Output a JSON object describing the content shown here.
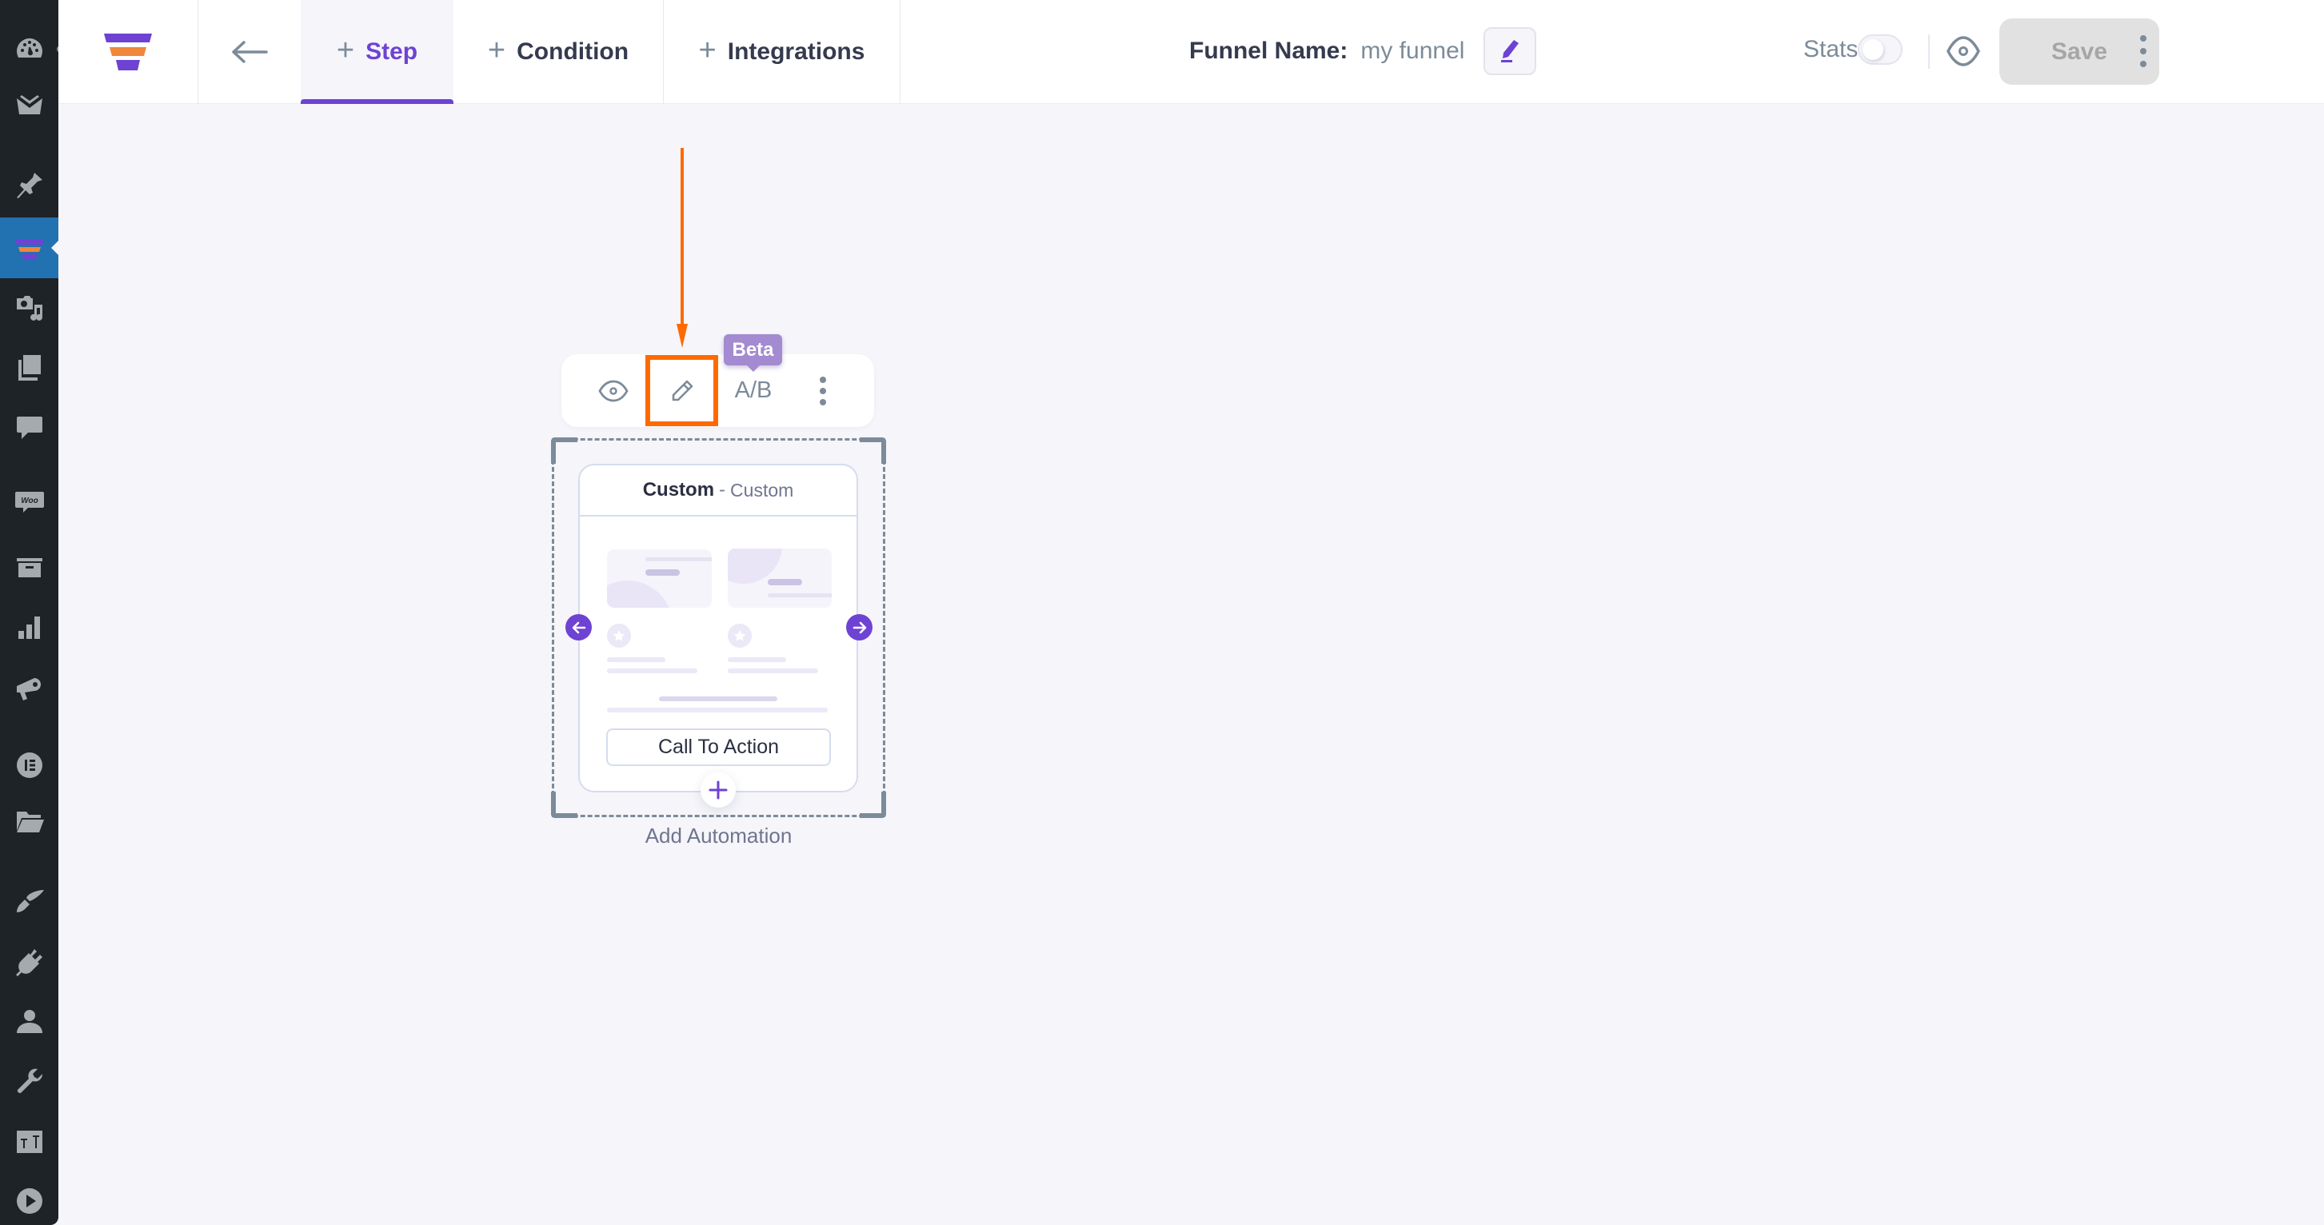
{
  "sidebar": {
    "items": [
      {
        "icon": "dashboard-icon"
      },
      {
        "icon": "mail-icon"
      },
      {
        "icon": "pin-icon"
      },
      {
        "icon": "funnel-icon",
        "active": true
      },
      {
        "icon": "media-icon"
      },
      {
        "icon": "pages-icon"
      },
      {
        "icon": "comments-icon"
      },
      {
        "icon": "woo-icon",
        "label": "Woo"
      },
      {
        "icon": "archive-icon"
      },
      {
        "icon": "analytics-icon"
      },
      {
        "icon": "megaphone-icon"
      },
      {
        "icon": "elementor-icon"
      },
      {
        "icon": "folder-icon"
      },
      {
        "icon": "brush-icon"
      },
      {
        "icon": "plugin-icon"
      },
      {
        "icon": "user-icon"
      },
      {
        "icon": "wrench-icon"
      },
      {
        "icon": "settings-sliders-icon"
      },
      {
        "icon": "play-icon"
      }
    ]
  },
  "header": {
    "tabs": [
      {
        "label": "Step",
        "active": true
      },
      {
        "label": "Condition"
      },
      {
        "label": "Integrations"
      }
    ],
    "funnel_name_label": "Funnel Name:",
    "funnel_name_value": "my funnel",
    "stats_label": "Stats",
    "stats_enabled": false,
    "save_label": "Save"
  },
  "canvas": {
    "toolbar": {
      "ab_label": "A/B",
      "beta_badge": "Beta"
    },
    "step": {
      "title": "Custom",
      "separator": "-",
      "type": "Custom",
      "cta_label": "Call To Action"
    },
    "add_automation_label": "Add Automation"
  },
  "colors": {
    "brand_purple": "#6e42d3",
    "brand_orange": "#f0873a",
    "annotation_orange": "#ff6a00",
    "wp_sidebar": "#1d2327",
    "wp_active": "#2271b1"
  }
}
